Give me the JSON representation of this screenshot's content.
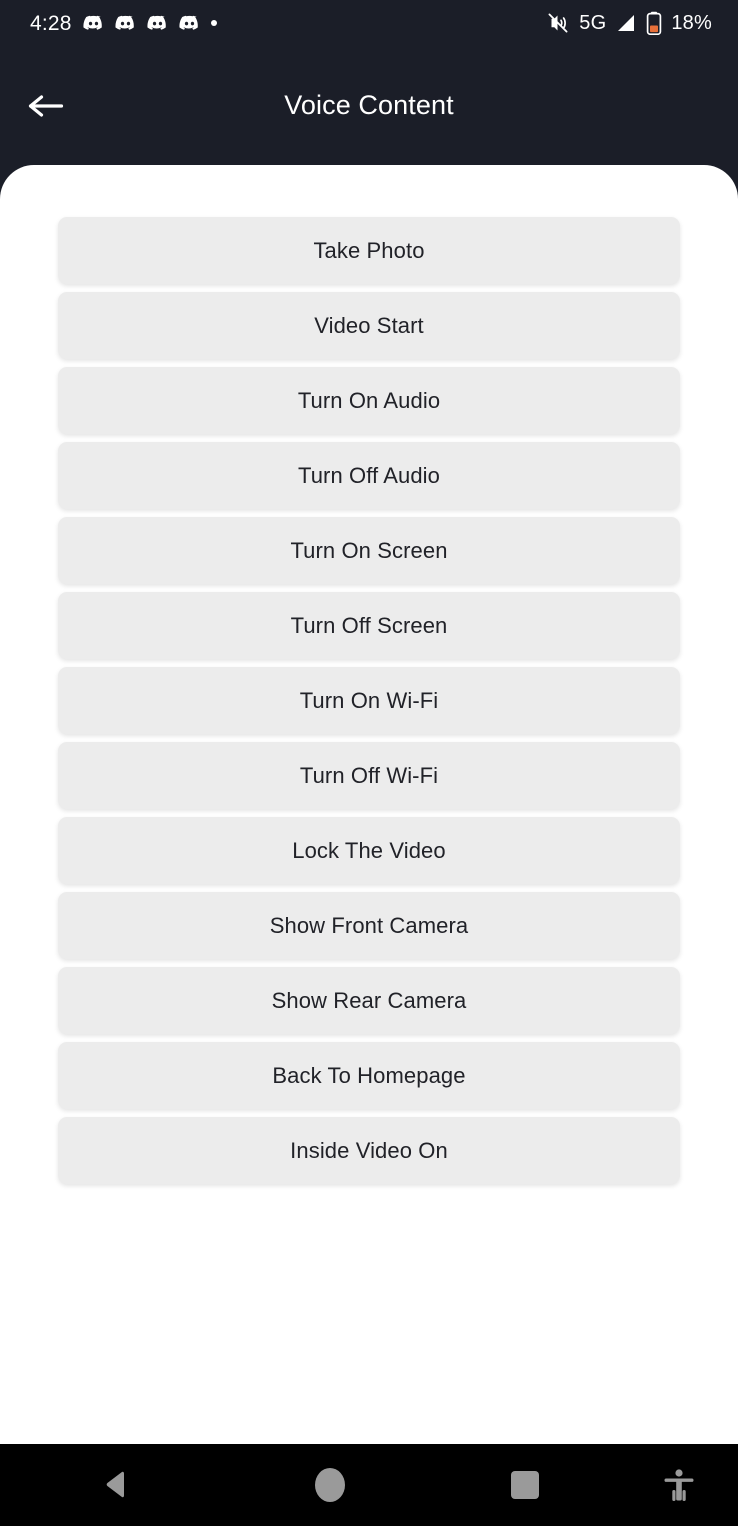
{
  "status_bar": {
    "time": "4:28",
    "notification_icons": [
      "discord-icon",
      "discord-icon",
      "discord-icon",
      "discord-icon",
      "more-dot-icon"
    ],
    "mute_icon": "volume-mute-icon",
    "network_type": "5G",
    "signal_icon": "signal-bars-icon",
    "battery_icon": "battery-low-icon",
    "battery_percent": "18%",
    "background_color": "#1b1e28",
    "text_color": "#ffffff",
    "battery_accent_color": "#e8703a"
  },
  "header": {
    "back_icon": "arrow-left-icon",
    "title": "Voice Content",
    "background_color": "#1b1e28",
    "title_color": "#ffffff"
  },
  "main": {
    "sheet_background": "#ffffff",
    "card_background": "#ececec",
    "card_text_color": "#212228",
    "commands": [
      {
        "label": "Take Photo"
      },
      {
        "label": "Video Start"
      },
      {
        "label": "Turn On Audio"
      },
      {
        "label": "Turn Off Audio"
      },
      {
        "label": "Turn On Screen"
      },
      {
        "label": "Turn Off Screen"
      },
      {
        "label": "Turn On Wi-Fi"
      },
      {
        "label": "Turn Off Wi-Fi"
      },
      {
        "label": "Lock The Video"
      },
      {
        "label": "Show Front Camera"
      },
      {
        "label": "Show Rear Camera"
      },
      {
        "label": "Back To Homepage"
      },
      {
        "label": "Inside Video On"
      }
    ]
  },
  "nav_bar": {
    "background_color": "#000000",
    "icon_color": "#9a9a9a",
    "buttons": [
      {
        "name": "back-nav-button",
        "icon": "triangle-back-icon"
      },
      {
        "name": "home-nav-button",
        "icon": "circle-home-icon"
      },
      {
        "name": "recents-nav-button",
        "icon": "square-recents-icon"
      },
      {
        "name": "accessibility-nav-button",
        "icon": "accessibility-person-icon"
      }
    ]
  }
}
